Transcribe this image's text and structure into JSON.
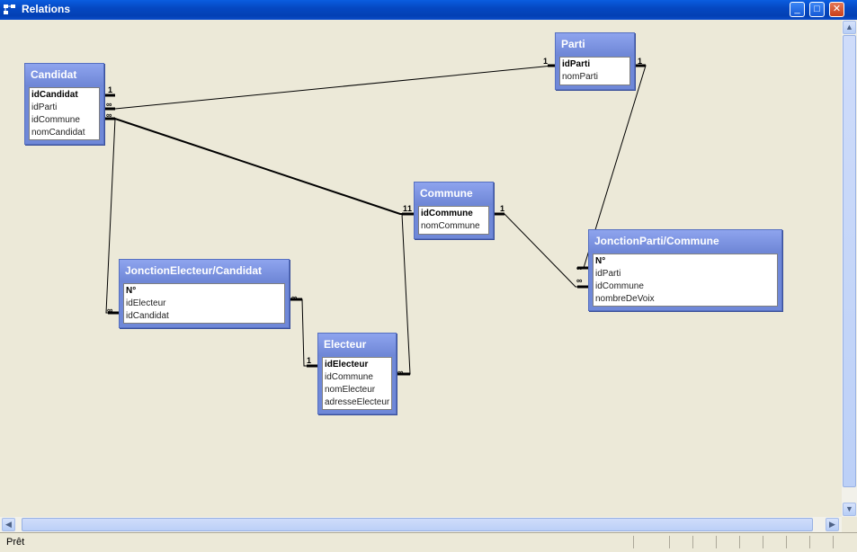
{
  "window": {
    "title": "Relations"
  },
  "status": {
    "text": "Prêt"
  },
  "tables": {
    "candidat": {
      "name": "Candidat",
      "fields": [
        "idCandidat",
        "idParti",
        "idCommune",
        "nomCandidat"
      ]
    },
    "parti": {
      "name": "Parti",
      "fields": [
        "idParti",
        "nomParti"
      ]
    },
    "commune": {
      "name": "Commune",
      "fields": [
        "idCommune",
        "nomCommune"
      ]
    },
    "jonction_parti_commune": {
      "name": "JonctionParti/Commune",
      "fields": [
        "N°",
        "idParti",
        "idCommune",
        "nombreDeVoix"
      ]
    },
    "jonction_electeur_candidat": {
      "name": "JonctionElecteur/Candidat",
      "fields": [
        "N°",
        "idElecteur",
        "idCandidat"
      ]
    },
    "electeur": {
      "name": "Electeur",
      "fields": [
        "idElecteur",
        "idCommune",
        "nomElecteur",
        "adresseElecteur"
      ]
    }
  },
  "cardinality": {
    "one": "1",
    "many": "∞"
  }
}
